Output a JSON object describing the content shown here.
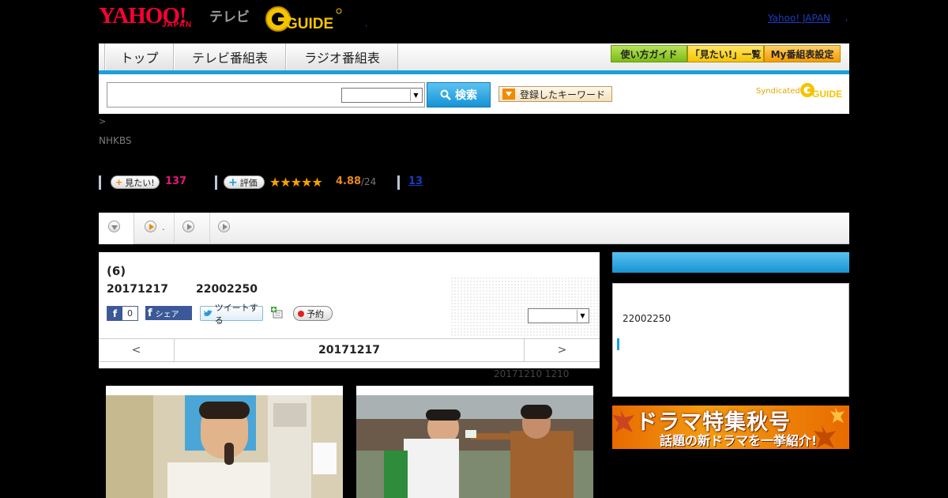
{
  "header": {
    "logo_yahoo": "YAHOO!",
    "logo_japan": "JAPAN",
    "logo_tv": "テレビ",
    "logo_g": "GUIDE",
    "yahoo_japan_link": "Yahoo! JAPAN",
    "dot_left": ",",
    "dot_right": ","
  },
  "nav": {
    "tabs": [
      "トップ",
      "テレビ番組表",
      "ラジオ番組表"
    ],
    "buttons": [
      "使い方ガイド",
      "「見たい!」一覧",
      "My番組表設定"
    ]
  },
  "search": {
    "input_value": "",
    "select_value": "",
    "search_label": "検索",
    "keyword_label": "登録したキーワード",
    "syndicated": "Syndicated",
    "syndicated_logo": "GUIDE"
  },
  "program": {
    "breadcrumb": ">",
    "channel": "NHKBS",
    "watch_label": "見たい!",
    "watch_count": "137",
    "rate_label": "評価",
    "stars": "★★★★★",
    "rating": "4.88",
    "rating_total": "/24",
    "comments": "13",
    "subtab_dot": "."
  },
  "episode": {
    "title": "(6)",
    "date": "20171217",
    "time": "22002250",
    "fb_like_count": "0",
    "fb_share": "シェア",
    "tweet": "ツイートする",
    "reserve": "予約",
    "select_value": "",
    "prev_arrow": "<",
    "nav_date": "20171217",
    "next_arrow": ">",
    "prev_info": "20171210  1210"
  },
  "sidebar": {
    "time": "22002250"
  },
  "banner": {
    "line1": "ドラマ特集秋号",
    "line2": "話題の新ドラマを一挙紹介!"
  },
  "colors": {
    "brand_red": "#ff0033",
    "accent_blue": "#1aa0de",
    "watch_pink": "#e6157a",
    "rating_orange": "#e6891a"
  }
}
